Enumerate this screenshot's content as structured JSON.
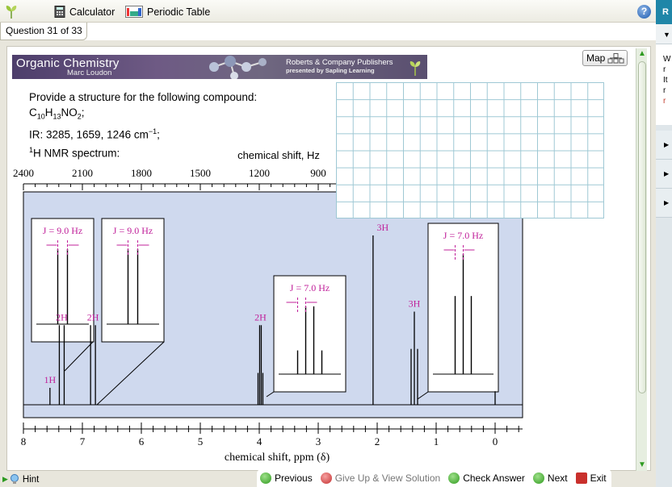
{
  "toolbar": {
    "calculator_label": "Calculator",
    "periodic_table_label": "Periodic Table",
    "help_symbol": "?"
  },
  "question_tab": "Question 31 of 33",
  "banner": {
    "course": "Organic Chemistry",
    "author": "Marc Loudon",
    "publisher": "Roberts & Company Publishers",
    "presented_by": "presented by Sapling Learning"
  },
  "map_button": "Map",
  "question": {
    "prompt": "Provide a structure for the following compound:",
    "formula": {
      "c": "C",
      "c_sub": "10",
      "h": "H",
      "h_sub": "13",
      "rest": "NO",
      "o_sub": "2",
      "end": ";"
    },
    "ir": {
      "text": "IR: 3285, 1659, 1246 cm",
      "sup": "−1",
      "end": ";"
    },
    "nmr": {
      "sup": "1",
      "text": "H NMR spectrum:"
    }
  },
  "chart_data": {
    "type": "line",
    "title": "",
    "top_axis_label": "chemical shift, Hz",
    "top_ticks": [
      "2400",
      "2100",
      "1800",
      "1500",
      "1200",
      "900"
    ],
    "xlabel": "chemical shift, ppm (δ)",
    "x_ticks": [
      "8",
      "7",
      "6",
      "5",
      "4",
      "3",
      "2",
      "1",
      "0"
    ],
    "xlim": [
      8,
      0
    ],
    "background": "#cfd9ee",
    "accent": "#c0209a",
    "peaks": [
      {
        "ppm": 7.55,
        "height": 0.1,
        "label": "1H"
      },
      {
        "ppm": 7.35,
        "height": 0.47,
        "label": "2H"
      },
      {
        "ppm": 6.82,
        "height": 0.47,
        "label": "2H"
      },
      {
        "ppm": 3.98,
        "height": 0.47,
        "label": "2H"
      },
      {
        "ppm": 2.07,
        "height": 1.0,
        "label": "3H"
      },
      {
        "ppm": 1.37,
        "height": 0.55,
        "label": "3H"
      },
      {
        "ppm": 0.0,
        "height": 0.08,
        "label": ""
      }
    ],
    "insets": [
      {
        "j": "J = 9.0 Hz",
        "lines": 2
      },
      {
        "j": "J = 9.0 Hz",
        "lines": 2
      },
      {
        "j": "J = 7.0 Hz",
        "lines": 4
      },
      {
        "j": "J = 7.0 Hz",
        "lines": 3
      }
    ]
  },
  "bottom": {
    "hint": "Hint",
    "previous": "Previous",
    "give_up": "Give Up & View Solution",
    "check": "Check Answer",
    "next": "Next",
    "exit": "Exit"
  },
  "sidebar": {
    "header": "R",
    "text_lines": [
      "W",
      "r",
      "It",
      "r",
      "r"
    ]
  }
}
